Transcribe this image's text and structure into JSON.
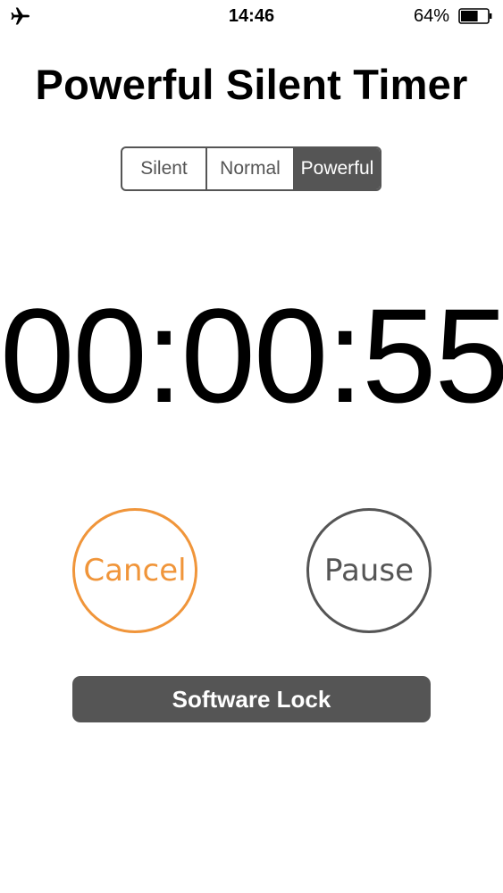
{
  "status_bar": {
    "time": "14:46",
    "battery_percent": "64%",
    "battery_level": 0.64,
    "icons": [
      "airplane-mode-icon",
      "battery-icon"
    ]
  },
  "title": "Powerful Silent Timer",
  "mode_selector": {
    "options": [
      "Silent",
      "Normal",
      "Powerful"
    ],
    "selected": "Powerful"
  },
  "timer": {
    "display": "00:00:55"
  },
  "buttons": {
    "cancel_label": "Cancel",
    "pause_label": "Pause",
    "lock_label": "Software Lock"
  },
  "colors": {
    "accent_cancel": "#f0953a",
    "dark_gray": "#555555",
    "background": "#ffffff"
  }
}
